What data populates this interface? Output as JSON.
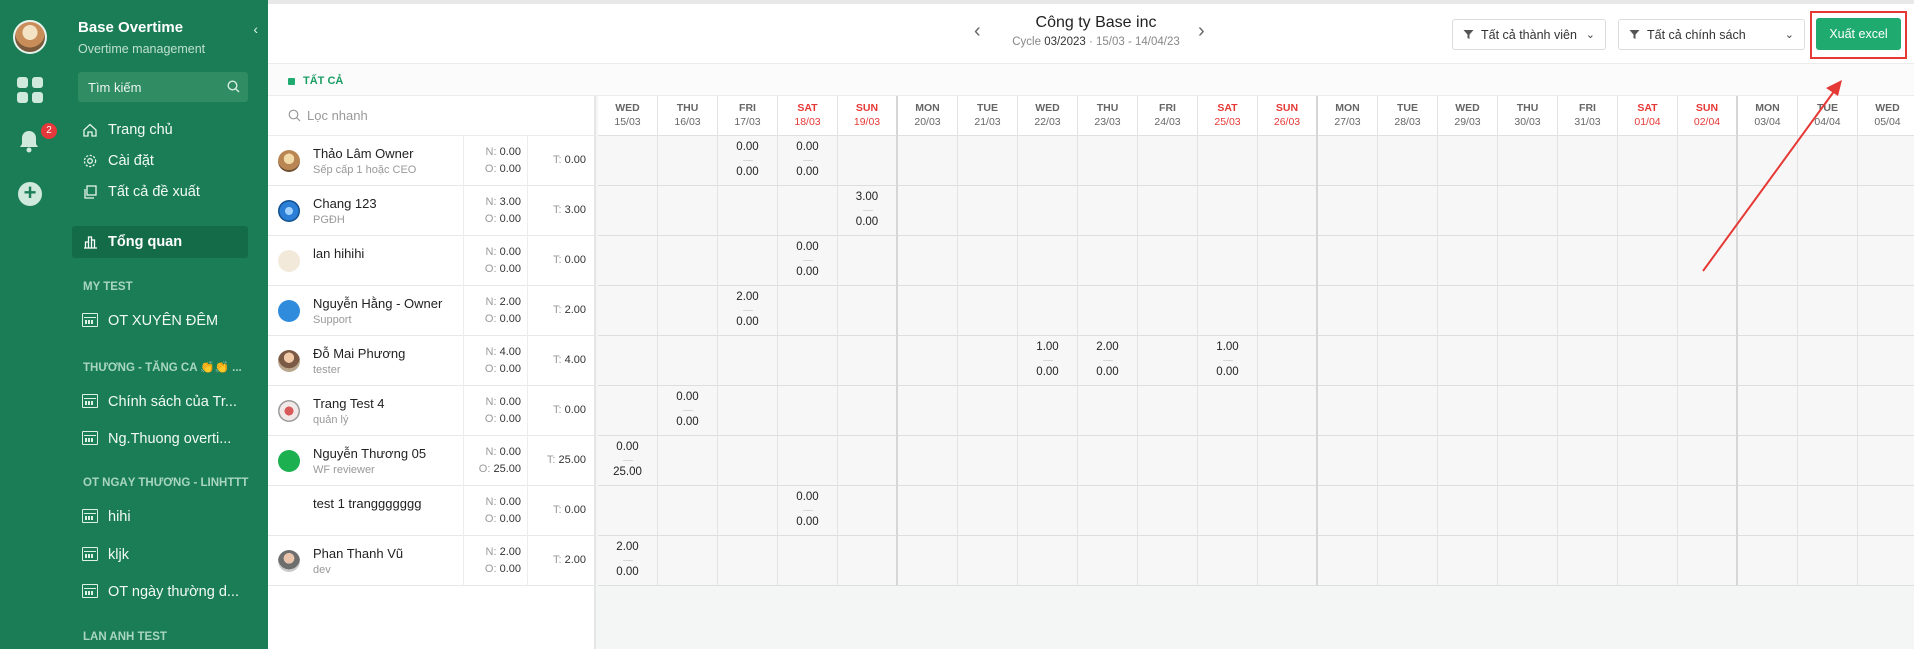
{
  "app": {
    "title": "Base Overtime",
    "subtitle": "Overtime management",
    "notification_count": "2"
  },
  "sidebar": {
    "search_label": "Tìm kiếm",
    "nav": [
      {
        "label": "Trang chủ",
        "icon": "home-icon"
      },
      {
        "label": "Cài đặt",
        "icon": "gear-icon"
      },
      {
        "label": "Tất cả đề xuất",
        "icon": "copy-icon"
      },
      {
        "label": "Tổng quan",
        "icon": "bar-chart-icon",
        "active": true
      }
    ],
    "sections": [
      {
        "title": "MY TEST",
        "items": [
          "OT XUYÊN ĐÊM"
        ]
      },
      {
        "title": "THƯƠNG - TĂNG CA 👏👏 ...",
        "items": [
          "Chính sách của Tr...",
          "Ng.Thuong overti..."
        ]
      },
      {
        "title": "OT NGÀY THƯỜNG - LINHTTT",
        "items": [
          "hihi",
          "kljk",
          "OT ngày thường d..."
        ]
      },
      {
        "title": "LAN ANH TEST",
        "items": []
      }
    ]
  },
  "header": {
    "company": "Công ty Base inc",
    "cycle_prefix": "Cycle",
    "cycle_value": "03/2023",
    "cycle_range": "· 15/03 - 14/04/23",
    "filter_members": "Tất cả thành viên",
    "filter_policies": "Tất cả chính sách",
    "export_label": "Xuất excel"
  },
  "tag_label": "TẤT CẢ",
  "quick_filter_placeholder": "Lọc nhanh",
  "colors": {
    "brand_green": "#1a7d55",
    "export_button": "#1faa6f",
    "weekend_red": "#e53935",
    "annotation_red": "#e53935"
  },
  "days": [
    {
      "dow": "WED",
      "date": "15/03"
    },
    {
      "dow": "THU",
      "date": "16/03"
    },
    {
      "dow": "FRI",
      "date": "17/03"
    },
    {
      "dow": "SAT",
      "date": "18/03",
      "weekend": true
    },
    {
      "dow": "SUN",
      "date": "19/03",
      "weekend": true
    },
    {
      "dow": "MON",
      "date": "20/03"
    },
    {
      "dow": "TUE",
      "date": "21/03"
    },
    {
      "dow": "WED",
      "date": "22/03"
    },
    {
      "dow": "THU",
      "date": "23/03"
    },
    {
      "dow": "FRI",
      "date": "24/03"
    },
    {
      "dow": "SAT",
      "date": "25/03",
      "weekend": true
    },
    {
      "dow": "SUN",
      "date": "26/03",
      "weekend": true
    },
    {
      "dow": "MON",
      "date": "27/03"
    },
    {
      "dow": "TUE",
      "date": "28/03"
    },
    {
      "dow": "WED",
      "date": "29/03"
    },
    {
      "dow": "THU",
      "date": "30/03"
    },
    {
      "dow": "FRI",
      "date": "31/03"
    },
    {
      "dow": "SAT",
      "date": "01/04",
      "weekend": true
    },
    {
      "dow": "SUN",
      "date": "02/04",
      "weekend": true
    },
    {
      "dow": "MON",
      "date": "03/04"
    },
    {
      "dow": "TUE",
      "date": "04/04"
    },
    {
      "dow": "WED",
      "date": "05/04"
    }
  ],
  "employees": [
    {
      "name": "Thảo Lâm Owner",
      "role": "Sếp cấp 1 hoặc CEO",
      "n": "0.00",
      "o": "0.00",
      "t": "0.00",
      "avatar": "photo-sunset",
      "entries": [
        {
          "day": 2,
          "top": "0.00",
          "bottom": "0.00"
        },
        {
          "day": 3,
          "top": "0.00",
          "bottom": "0.00"
        }
      ]
    },
    {
      "name": "Chang 123",
      "role": "PGĐH",
      "n": "3.00",
      "o": "0.00",
      "t": "3.00",
      "avatar": "photo-blue-flower",
      "entries": [
        {
          "day": 4,
          "top": "3.00",
          "bottom": "0.00"
        }
      ]
    },
    {
      "name": "lan hihihi",
      "role": "",
      "n": "0.00",
      "o": "0.00",
      "t": "0.00",
      "avatar": "blank-beige",
      "entries": [
        {
          "day": 3,
          "top": "0.00",
          "bottom": "0.00"
        }
      ]
    },
    {
      "name": "Nguyễn Hằng - Owner",
      "role": "Support",
      "n": "2.00",
      "o": "0.00",
      "t": "2.00",
      "avatar": "blue-hexagon-logo",
      "entries": [
        {
          "day": 2,
          "top": "2.00",
          "bottom": "0.00"
        }
      ]
    },
    {
      "name": "Đỗ Mai Phương",
      "role": "tester",
      "n": "4.00",
      "o": "0.00",
      "t": "4.00",
      "avatar": "photo-person",
      "entries": [
        {
          "day": 7,
          "top": "1.00",
          "bottom": "0.00"
        },
        {
          "day": 8,
          "top": "2.00",
          "bottom": "0.00"
        },
        {
          "day": 10,
          "top": "1.00",
          "bottom": "0.00"
        }
      ]
    },
    {
      "name": "Trang Test 4",
      "role": "quản lý",
      "n": "0.00",
      "o": "0.00",
      "t": "0.00",
      "avatar": "photo-red-flower",
      "entries": [
        {
          "day": 1,
          "top": "0.00",
          "bottom": "0.00"
        }
      ]
    },
    {
      "name": "Nguyễn Thương 05",
      "role": "WF reviewer",
      "n": "0.00",
      "o": "25.00",
      "t": "25.00",
      "avatar": "green-circle-logo",
      "entries": [
        {
          "day": 0,
          "top": "0.00",
          "bottom": "25.00"
        }
      ]
    },
    {
      "name": "test 1 tranggggggg",
      "role": "",
      "n": "0.00",
      "o": "0.00",
      "t": "0.00",
      "avatar": "text-logo",
      "entries": [
        {
          "day": 3,
          "top": "0.00",
          "bottom": "0.00"
        }
      ]
    },
    {
      "name": "Phan Thanh Vũ",
      "role": "dev",
      "n": "2.00",
      "o": "0.00",
      "t": "2.00",
      "avatar": "photo-person-2",
      "entries": [
        {
          "day": 0,
          "top": "2.00",
          "bottom": "0.00"
        }
      ]
    }
  ],
  "labels": {
    "n": "N:",
    "o": "O:",
    "t": "T:"
  }
}
